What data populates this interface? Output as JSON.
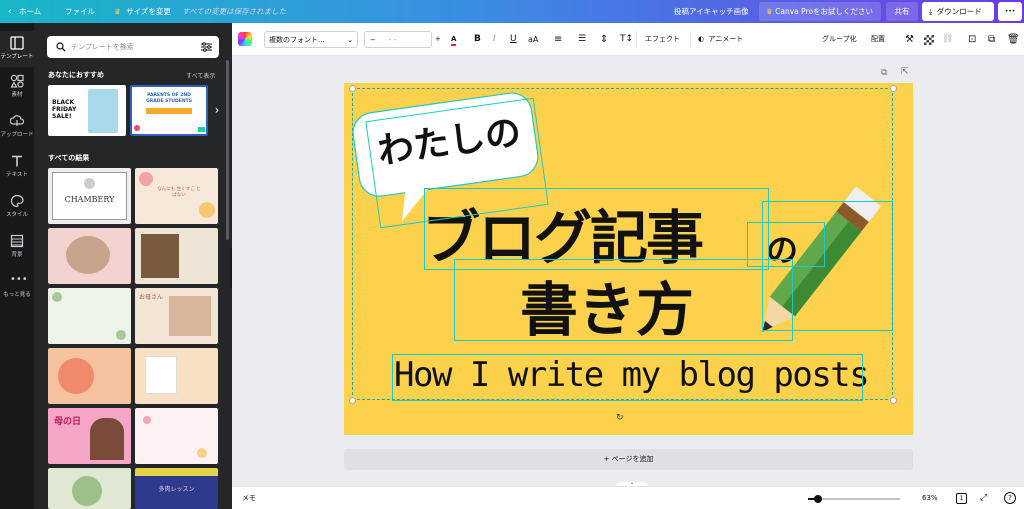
{
  "topbar": {
    "home": "ホーム",
    "file": "ファイル",
    "resize": "サイズを変更",
    "saved_status": "すべての変更は保存されました",
    "design_title": "投稿アイキャッチ画像",
    "try_pro": "Canva Proをお試しください",
    "share": "共有",
    "download": "ダウンロード",
    "more": "•••"
  },
  "rail": [
    {
      "label": "テンプレート",
      "icon": "template-icon"
    },
    {
      "label": "素材",
      "icon": "elements-icon"
    },
    {
      "label": "アップロード",
      "icon": "upload-icon"
    },
    {
      "label": "テキスト",
      "icon": "text-icon"
    },
    {
      "label": "スタイル",
      "icon": "style-icon"
    },
    {
      "label": "背景",
      "icon": "background-icon"
    },
    {
      "label": "もっと見る",
      "icon": "more-icon"
    }
  ],
  "panel": {
    "search_placeholder": "テンプレートを検索",
    "recommended_title": "あなたにおすすめ",
    "see_all": "すべて表示",
    "all_results_title": "すべての結果",
    "thumb_text_1": "BLACK FRIDAY SALE!",
    "thumb_text_2": "PARENTS OF 2ND GRADE STUDENTS",
    "thumb_text_3": "CHAMBERY",
    "thumb_text_4": "なんにも 生くすこ とばない",
    "thumb_text_5": "母の日",
    "thumb_text_6": "お母さん",
    "thumb_text_7": "多肉レッスン"
  },
  "toolbar": {
    "font": "複数のフォント...",
    "size": "- -",
    "minus": "−",
    "plus": "+",
    "effects": "エフェクト",
    "animate": "アニメート",
    "group": "グループ化",
    "position": "配置"
  },
  "design": {
    "bubble_text": "わたしの",
    "title_line1": "ブログ記事",
    "title_particle": "の",
    "title_line2": "書き方",
    "subtitle": "How I write my blog posts"
  },
  "add_page": "+ ページを追加",
  "bottombar": {
    "notes": "メモ",
    "zoom": "63%",
    "page_count": "1"
  },
  "colors": {
    "topbar_start": "#17b7c6",
    "topbar_end": "#6d3be6",
    "canvas_bg": "#fcd24c",
    "selection": "#1ec9c9"
  }
}
